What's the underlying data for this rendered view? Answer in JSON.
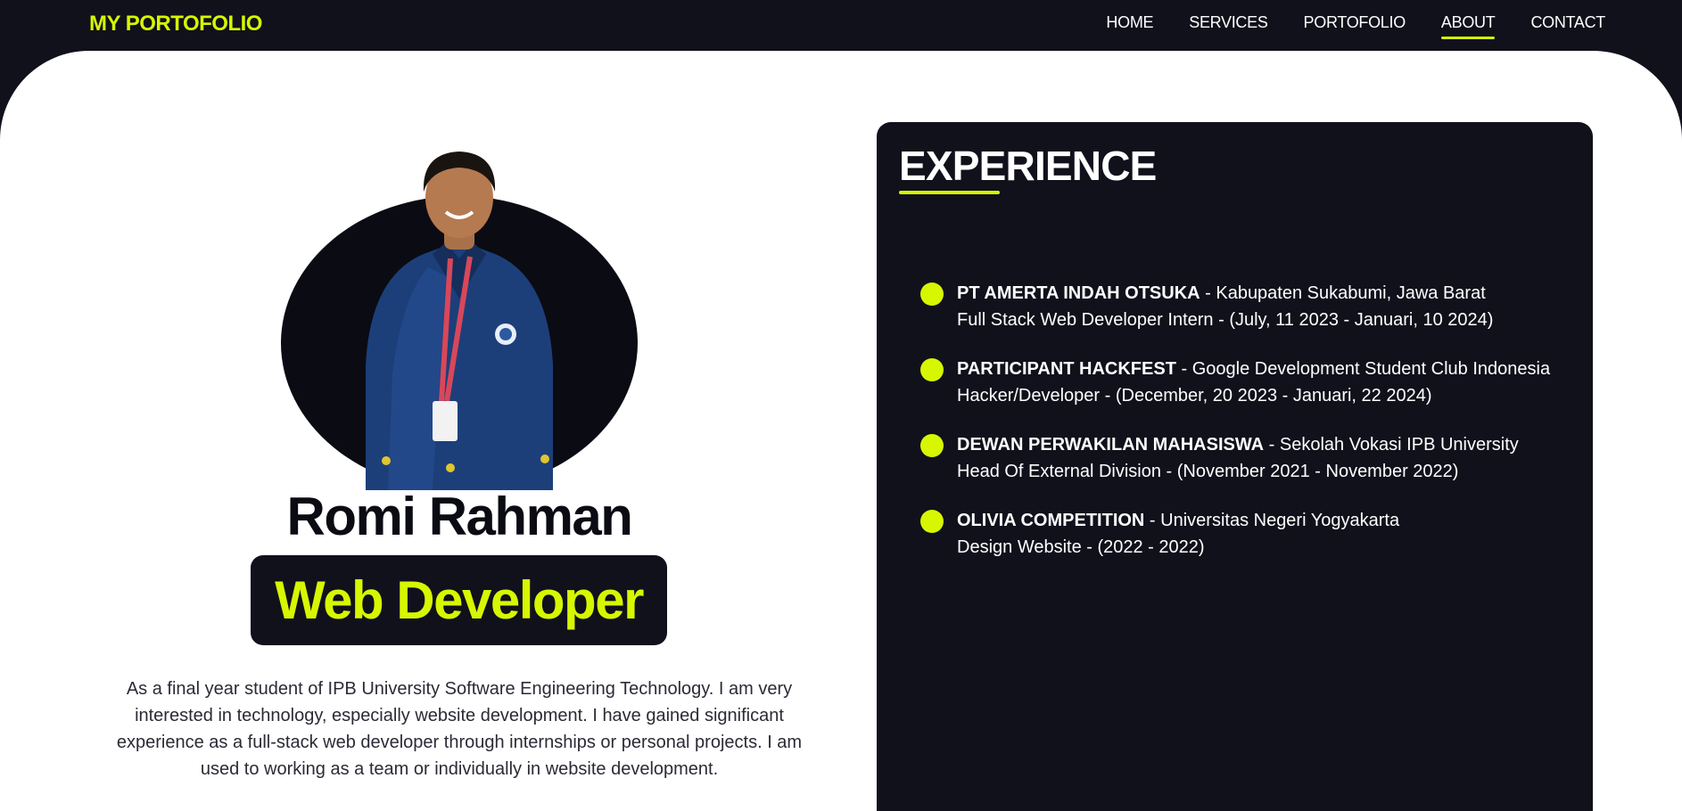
{
  "nav": {
    "brand": "MY PORTOFOLIO",
    "links": [
      "HOME",
      "SERVICES",
      "PORTOFOLIO",
      "ABOUT",
      "CONTACT"
    ],
    "active": "ABOUT"
  },
  "profile": {
    "name": "Romi Rahman",
    "role": "Web Developer",
    "bio": "As a final year student of IPB University Software Engineering Technology. I am very interested in technology, especially website development. I have gained significant experience as a full-stack web developer through internships or personal projects. I am used to working as a team or individually in website development."
  },
  "experience": {
    "title": "EXPERIENCE",
    "items": [
      {
        "org": "PT AMERTA INDAH OTSUKA",
        "location": " - Kabupaten Sukabumi, Jawa Barat",
        "detail": "Full Stack Web Developer Intern - (July, 11 2023 - Januari, 10 2024)"
      },
      {
        "org": "PARTICIPANT HACKFEST",
        "location": " - Google Development Student Club Indonesia",
        "detail": "Hacker/Developer - (December, 20 2023 - Januari, 22 2024)"
      },
      {
        "org": "DEWAN PERWAKILAN MAHASISWA",
        "location": " - Sekolah Vokasi IPB University",
        "detail": "Head Of External Division - (November 2021 - November 2022)"
      },
      {
        "org": "OLIVIA COMPETITION",
        "location": " - Universitas Negeri Yogyakarta",
        "detail": "Design Website - (2022 - 2022)"
      }
    ]
  },
  "colors": {
    "dark": "#11111c",
    "accent": "#d6f700",
    "white": "#ffffff"
  }
}
